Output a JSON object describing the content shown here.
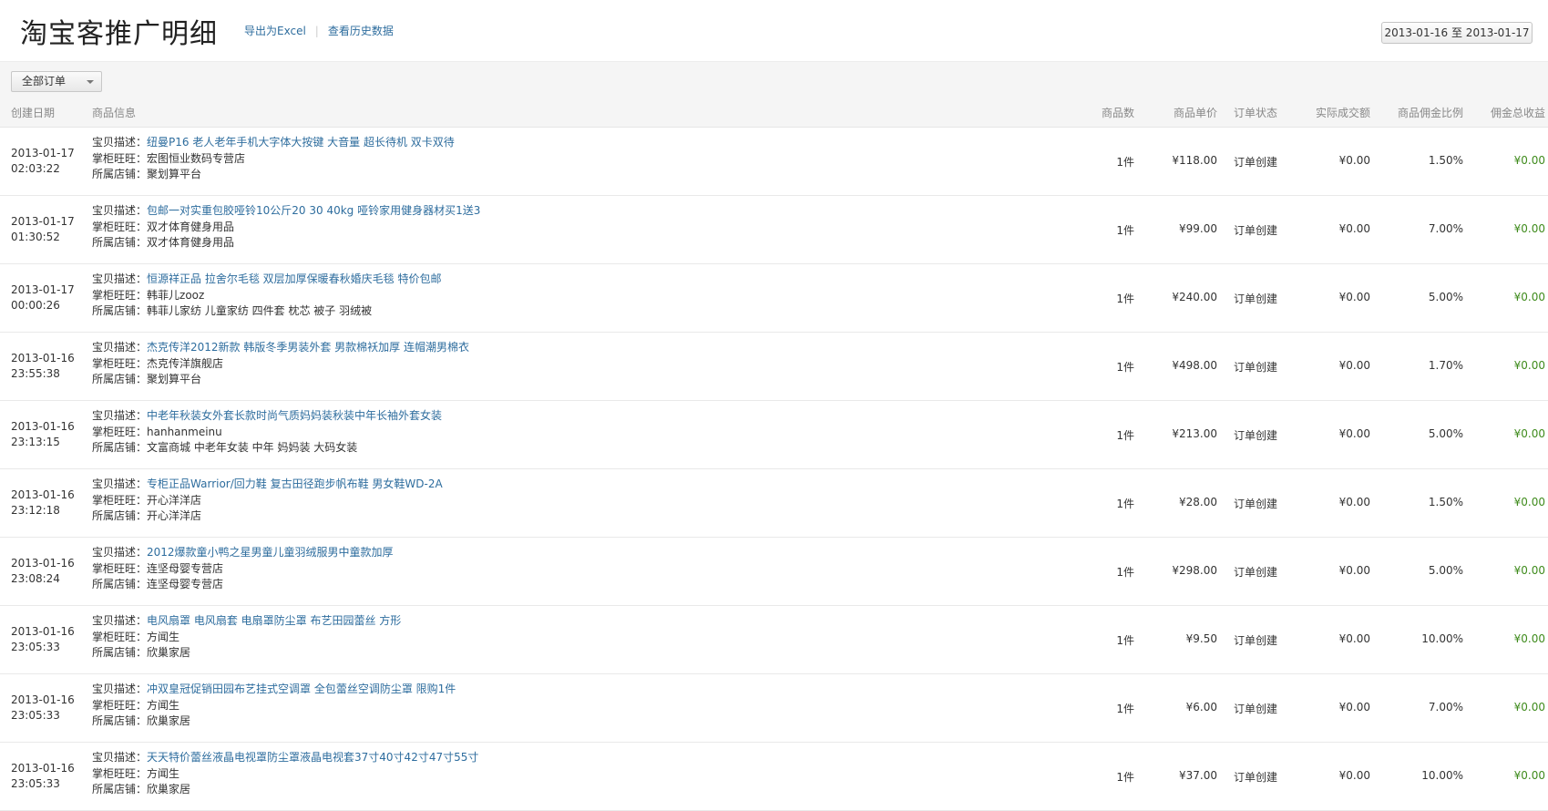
{
  "header": {
    "title": "淘宝客推广明细",
    "export_link": "导出为Excel",
    "history_link": "查看历史数据",
    "date_range": "2013-01-16 至 2013-01-17"
  },
  "filter": {
    "order_type": "全部订单"
  },
  "columns": {
    "date": "创建日期",
    "info": "商品信息",
    "qty": "商品数",
    "price": "商品单价",
    "status": "订单状态",
    "actual": "实际成交额",
    "rate": "商品佣金比例",
    "commission": "佣金总收益"
  },
  "labels": {
    "desc": "宝贝描述：",
    "seller": "掌柜旺旺：",
    "shop": "所属店铺："
  },
  "rows": [
    {
      "date": "2013-01-17",
      "time": "02:03:22",
      "desc": "纽曼P16 老人老年手机大字体大按键 大音量 超长待机 双卡双待",
      "seller": "宏图恒业数码专营店",
      "shop": "聚划算平台",
      "qty": "1件",
      "price": "¥118.00",
      "status": "订单创建",
      "actual": "¥0.00",
      "rate": "1.50%",
      "commission": "¥0.00"
    },
    {
      "date": "2013-01-17",
      "time": "01:30:52",
      "desc": "包邮一对实重包胶哑铃10公斤20 30 40kg 哑铃家用健身器材买1送3",
      "seller": "双才体育健身用品",
      "shop": "双才体育健身用品",
      "qty": "1件",
      "price": "¥99.00",
      "status": "订单创建",
      "actual": "¥0.00",
      "rate": "7.00%",
      "commission": "¥0.00"
    },
    {
      "date": "2013-01-17",
      "time": "00:00:26",
      "desc": "恒源祥正品 拉舍尔毛毯 双层加厚保暖春秋婚庆毛毯 特价包邮",
      "seller": "韩菲儿zooz",
      "shop": "韩菲儿家纺 儿童家纺 四件套 枕芯 被子 羽绒被",
      "qty": "1件",
      "price": "¥240.00",
      "status": "订单创建",
      "actual": "¥0.00",
      "rate": "5.00%",
      "commission": "¥0.00"
    },
    {
      "date": "2013-01-16",
      "time": "23:55:38",
      "desc": "杰克传洋2012新款 韩版冬季男装外套 男款棉袄加厚 连帽潮男棉衣",
      "seller": "杰克传洋旗舰店",
      "shop": "聚划算平台",
      "qty": "1件",
      "price": "¥498.00",
      "status": "订单创建",
      "actual": "¥0.00",
      "rate": "1.70%",
      "commission": "¥0.00"
    },
    {
      "date": "2013-01-16",
      "time": "23:13:15",
      "desc": "中老年秋装女外套长款时尚气质妈妈装秋装中年长袖外套女装",
      "seller": "hanhanmeinu",
      "shop": "文富商城 中老年女装 中年 妈妈装 大码女装",
      "qty": "1件",
      "price": "¥213.00",
      "status": "订单创建",
      "actual": "¥0.00",
      "rate": "5.00%",
      "commission": "¥0.00"
    },
    {
      "date": "2013-01-16",
      "time": "23:12:18",
      "desc": "专柜正品Warrior/回力鞋 复古田径跑步帆布鞋 男女鞋WD-2A",
      "seller": "开心洋洋店",
      "shop": "开心洋洋店",
      "qty": "1件",
      "price": "¥28.00",
      "status": "订单创建",
      "actual": "¥0.00",
      "rate": "1.50%",
      "commission": "¥0.00"
    },
    {
      "date": "2013-01-16",
      "time": "23:08:24",
      "desc": "2012爆款童小鸭之星男童儿童羽绒服男中童款加厚",
      "seller": "连坚母婴专营店",
      "shop": "连坚母婴专营店",
      "qty": "1件",
      "price": "¥298.00",
      "status": "订单创建",
      "actual": "¥0.00",
      "rate": "5.00%",
      "commission": "¥0.00"
    },
    {
      "date": "2013-01-16",
      "time": "23:05:33",
      "desc": "电风扇罩 电风扇套 电扇罩防尘罩 布艺田园蕾丝 方形",
      "seller": "方闻生",
      "shop": "欣巢家居",
      "qty": "1件",
      "price": "¥9.50",
      "status": "订单创建",
      "actual": "¥0.00",
      "rate": "10.00%",
      "commission": "¥0.00"
    },
    {
      "date": "2013-01-16",
      "time": "23:05:33",
      "desc": "冲双皇冠促销田园布艺挂式空调罩 全包蕾丝空调防尘罩 限购1件",
      "seller": "方闻生",
      "shop": "欣巢家居",
      "qty": "1件",
      "price": "¥6.00",
      "status": "订单创建",
      "actual": "¥0.00",
      "rate": "7.00%",
      "commission": "¥0.00"
    },
    {
      "date": "2013-01-16",
      "time": "23:05:33",
      "desc": "天天特价蕾丝液晶电视罩防尘罩液晶电视套37寸40寸42寸47寸55寸",
      "seller": "方闻生",
      "shop": "欣巢家居",
      "qty": "1件",
      "price": "¥37.00",
      "status": "订单创建",
      "actual": "¥0.00",
      "rate": "10.00%",
      "commission": "¥0.00"
    }
  ]
}
